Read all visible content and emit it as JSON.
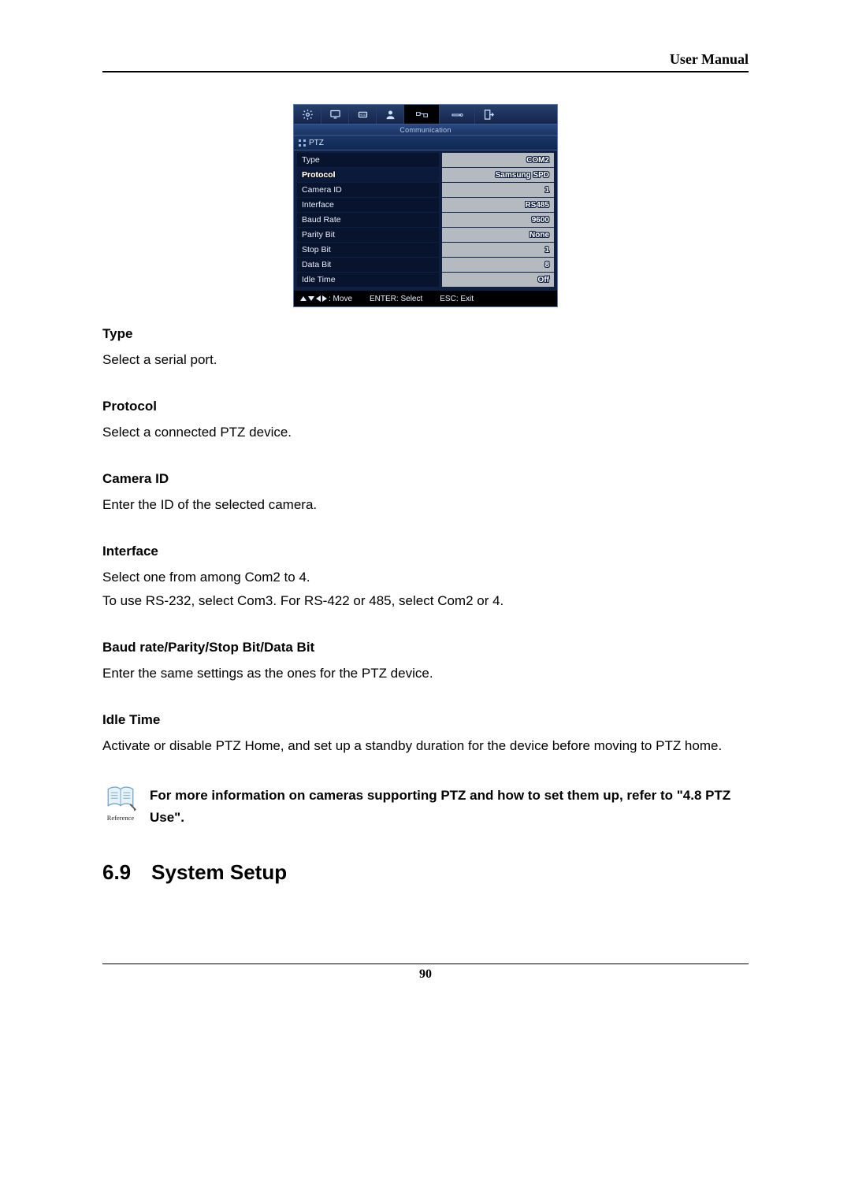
{
  "header": {
    "title": "User Manual"
  },
  "dvr": {
    "subheader": "Communication",
    "crumb": "PTZ",
    "rows": [
      {
        "label": "Type",
        "value": "COM2",
        "selected": false
      },
      {
        "label": "Protocol",
        "value": "Samsung SPD",
        "selected": true
      },
      {
        "label": "Camera ID",
        "value": "1",
        "selected": false
      },
      {
        "label": "Interface",
        "value": "RS485",
        "selected": false
      },
      {
        "label": "Baud Rate",
        "value": "9600",
        "selected": false
      },
      {
        "label": "Parity Bit",
        "value": "None",
        "selected": false
      },
      {
        "label": "Stop Bit",
        "value": "1",
        "selected": false
      },
      {
        "label": "Data Bit",
        "value": "8",
        "selected": false
      },
      {
        "label": "Idle Time",
        "value": "Off",
        "selected": false
      }
    ],
    "footer": {
      "move": ": Move",
      "select": "ENTER: Select",
      "exit": "ESC: Exit"
    }
  },
  "descriptions": [
    {
      "title": "Type",
      "text": "Select a serial port."
    },
    {
      "title": "Protocol",
      "text": "Select a connected PTZ device."
    },
    {
      "title": "Camera ID",
      "text": "Enter the ID of the selected camera."
    },
    {
      "title": "Interface",
      "text": "Select one from among Com2 to 4.\nTo use RS-232, select Com3. For RS-422 or 485, select Com2 or 4."
    },
    {
      "title": "Baud rate/Parity/Stop Bit/Data Bit",
      "text": "Enter the same settings as the ones for the PTZ device."
    },
    {
      "title": "Idle Time",
      "text": "Activate or disable PTZ Home, and set up a standby duration for the device before moving to PTZ home."
    }
  ],
  "reference": {
    "icon_label": "Reference",
    "text": "For more information on cameras supporting PTZ and how to set them up, refer to \"4.8 PTZ Use\"."
  },
  "section": {
    "number": "6.9",
    "title": "System Setup"
  },
  "footer": {
    "page_number": "90"
  }
}
